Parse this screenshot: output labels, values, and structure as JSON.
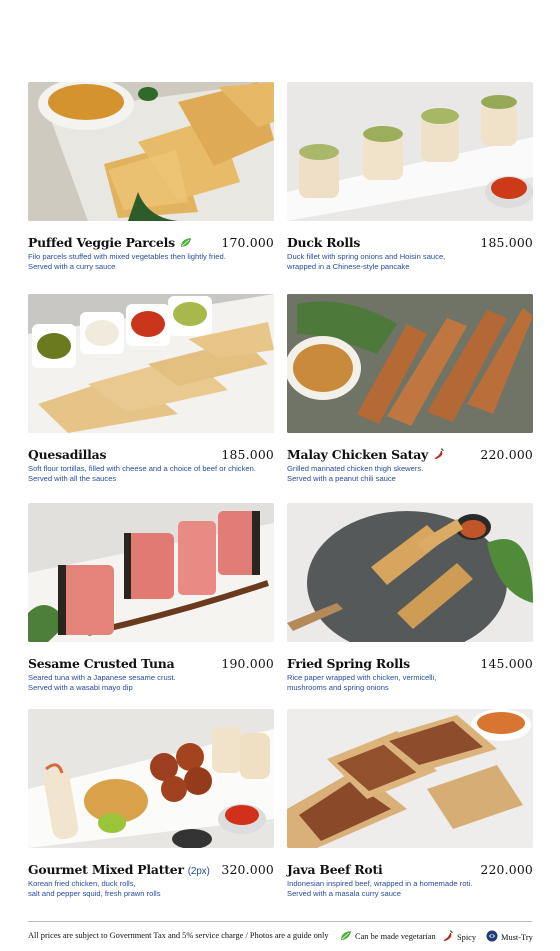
{
  "menu": {
    "items": [
      {
        "name": "Puffed Veggie Parcels",
        "note": "",
        "price": "170.000",
        "badge": "vegetarian",
        "desc": [
          "Filo parcels stuffed with mixed vegetables then lightly fried.",
          "Served with a curry sauce"
        ]
      },
      {
        "name": "Duck Rolls",
        "note": "",
        "price": "185.000",
        "badge": "",
        "desc": [
          "Duck fillet with spring onions and Hoisin sauce,",
          "wrapped in a Chinese-style pancake"
        ]
      },
      {
        "name": "Quesadillas",
        "note": "",
        "price": "185.000",
        "badge": "",
        "desc": [
          "Soft flour tortillas, filled with cheese and a choice of beef or chicken.",
          "Served with all the sauces"
        ]
      },
      {
        "name": "Malay Chicken Satay",
        "note": "",
        "price": "220.000",
        "badge": "spicy",
        "desc": [
          "Grilled marinated chicken thigh skewers.",
          "Served with a peanut chili sauce"
        ]
      },
      {
        "name": "Sesame Crusted Tuna",
        "note": "",
        "price": "190.000",
        "badge": "",
        "desc": [
          "Seared tuna with a Japanese sesame crust.",
          "Served with a wasabi mayo dip"
        ]
      },
      {
        "name": "Fried Spring Rolls",
        "note": "",
        "price": "145.000",
        "badge": "",
        "desc": [
          "Rice paper wrapped with chicken, vermicelli,",
          "mushrooms and spring onions"
        ]
      },
      {
        "name": "Gourmet Mixed Platter",
        "note": "(2px)",
        "price": "320.000",
        "badge": "",
        "desc": [
          "Korean fried chicken, duck rolls,",
          "salt and pepper squid, fresh prawn rolls"
        ]
      },
      {
        "name": "Java Beef Roti",
        "note": "",
        "price": "220.000",
        "badge": "",
        "desc": [
          "Indonesian inspired beef, wrapped in a homemade roti.",
          "Served with a masala curry sauce"
        ]
      }
    ]
  },
  "footer": {
    "note": "All prices are subject to Government Tax and 5% service charge / Photos are a guide only",
    "legend_vegetarian": "Can be made vegetarian",
    "legend_spicy": "Spicy",
    "legend_must_try": "Must-Try"
  },
  "colors": {
    "accent_text": "#2a4ba0",
    "vegetarian_icon": "#4caf3a",
    "spicy_icon": "#c0281e",
    "must_try_icon": "#1f3a7a"
  },
  "icons": {
    "vegetarian": "leaf-icon",
    "spicy": "chili-icon",
    "must_try": "must-try-icon"
  }
}
